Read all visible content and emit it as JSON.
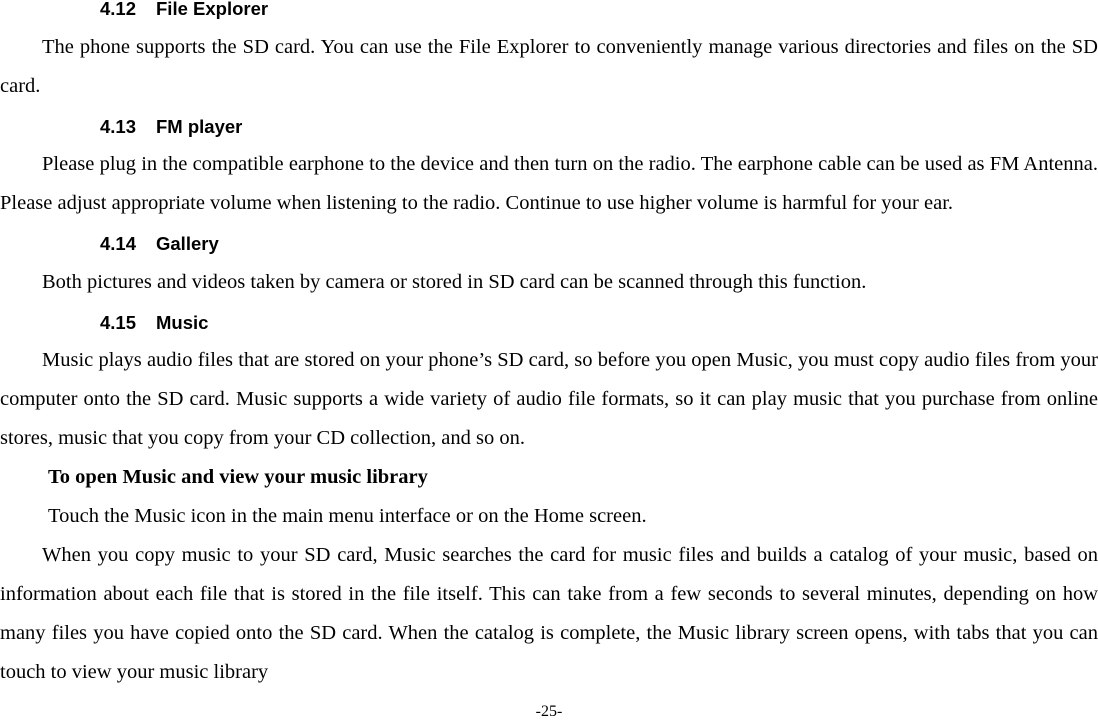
{
  "document": {
    "page_number_label": "-25-"
  },
  "sections": [
    {
      "number": "4.12",
      "title": "File Explorer",
      "body": "The phone supports the SD card. You can use the File Explorer to conveniently manage various directories and files on the SD card."
    },
    {
      "number": "4.13",
      "title": "FM player",
      "body": "Please plug in the compatible earphone to the device and then turn on the radio. The earphone cable can be used as FM Antenna. Please adjust appropriate volume when listening to the radio. Continue to use higher volume is harmful for your ear."
    },
    {
      "number": "4.14",
      "title": "Gallery",
      "body": "Both pictures and videos taken by camera or stored in SD card can be scanned through this function."
    },
    {
      "number": "4.15",
      "title": "Music",
      "body": "Music plays audio files that are stored on your phone’s SD card, so before you open Music, you must copy audio files from your computer onto the SD card. Music supports a wide variety of audio file formats, so it can play music that you purchase from online stores, music that you copy from your CD collection, and so on.",
      "subsection": {
        "heading": "To open Music and view your music library",
        "line": "Touch the Music icon in the main menu interface or on the Home screen.",
        "body": "When you copy music to your SD card, Music searches the card for music files and builds a catalog of your music, based on information about each file that is stored in the file itself. This can take from a few seconds to several minutes, depending on how many files you have copied onto the SD card. When the catalog is complete, the Music library screen opens, with tabs that you can touch to view your music library"
      }
    }
  ]
}
